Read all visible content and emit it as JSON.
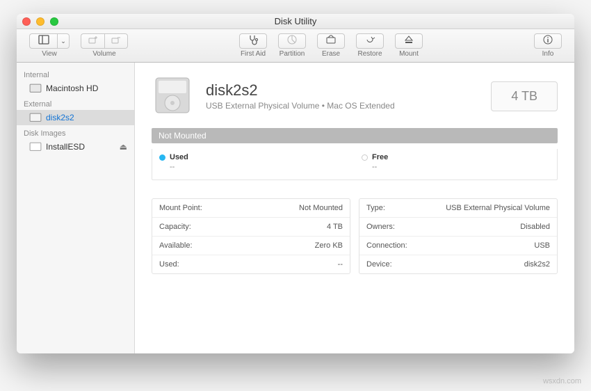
{
  "window": {
    "title": "Disk Utility"
  },
  "toolbar": {
    "view": "View",
    "volume": "Volume",
    "firstAid": "First Aid",
    "partition": "Partition",
    "erase": "Erase",
    "restore": "Restore",
    "mount": "Mount",
    "info": "Info"
  },
  "sidebar": {
    "internal": "Internal",
    "external": "External",
    "diskImages": "Disk Images",
    "items": {
      "macintosh": "Macintosh HD",
      "disk2s2": "disk2s2",
      "installESD": "InstallESD"
    }
  },
  "volume": {
    "name": "disk2s2",
    "subtitle": "USB External Physical Volume • Mac OS Extended",
    "capacity": "4 TB",
    "status": "Not Mounted",
    "usage": {
      "usedLabel": "Used",
      "usedValue": "--",
      "freeLabel": "Free",
      "freeValue": "--"
    },
    "infoLeft": [
      {
        "label": "Mount Point:",
        "value": "Not Mounted"
      },
      {
        "label": "Capacity:",
        "value": "4 TB"
      },
      {
        "label": "Available:",
        "value": "Zero KB"
      },
      {
        "label": "Used:",
        "value": "--"
      }
    ],
    "infoRight": [
      {
        "label": "Type:",
        "value": "USB External Physical Volume"
      },
      {
        "label": "Owners:",
        "value": "Disabled"
      },
      {
        "label": "Connection:",
        "value": "USB"
      },
      {
        "label": "Device:",
        "value": "disk2s2"
      }
    ]
  },
  "watermark": "wsxdn.com"
}
